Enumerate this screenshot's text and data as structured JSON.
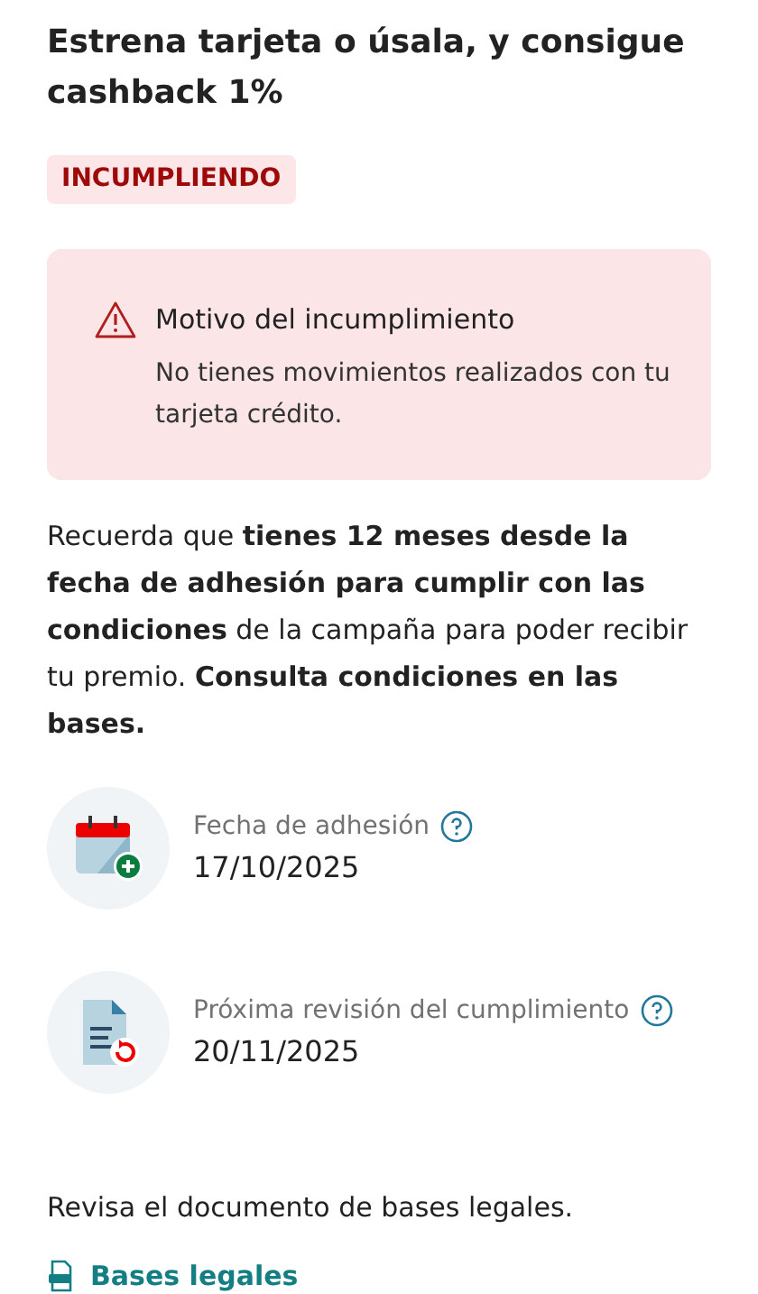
{
  "title": "Estrena tarjeta o úsala, y consigue cashback 1%",
  "status_badge": "INCUMPLIENDO",
  "alert": {
    "title": "Motivo del incumplimiento",
    "message": "No tienes movimientos realizados con tu tarjeta crédito."
  },
  "info_paragraph": "Recuerda que **tienes 12 meses desde la fecha de adhesión para cumplir con las condiciones** de la campaña para poder recibir tu premio. **Consulta condiciones en las bases.**",
  "dates": [
    {
      "kind": "calendar",
      "label": "Fecha de adhesión",
      "value": "17/10/2025"
    },
    {
      "kind": "document",
      "label": "Próxima revisión del cumplimiento",
      "value": "20/11/2025"
    }
  ],
  "legal_text": "Revisa el documento de bases legales.",
  "legal_link": "Bases legales"
}
